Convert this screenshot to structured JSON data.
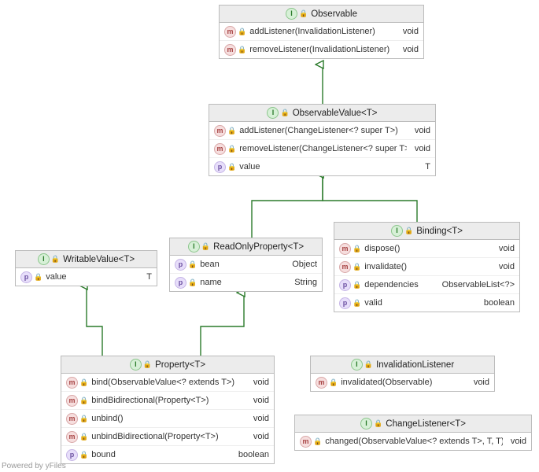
{
  "footer": "Powered by yFiles",
  "nodes": {
    "observable": {
      "title": "Observable",
      "members": [
        {
          "kind": "m",
          "sig": "addListener(InvalidationListener)",
          "ret": "void"
        },
        {
          "kind": "m",
          "sig": "removeListener(InvalidationListener)",
          "ret": "void"
        }
      ]
    },
    "observableValue": {
      "title": "ObservableValue<T>",
      "members": [
        {
          "kind": "m",
          "sig": "addListener(ChangeListener<? super T>)",
          "ret": "void"
        },
        {
          "kind": "m",
          "sig": "removeListener(ChangeListener<? super T>)",
          "ret": "void"
        },
        {
          "kind": "p",
          "sig": "value",
          "ret": "T"
        }
      ]
    },
    "writableValue": {
      "title": "WritableValue<T>",
      "members": [
        {
          "kind": "p",
          "sig": "value",
          "ret": "T"
        }
      ]
    },
    "readOnlyProperty": {
      "title": "ReadOnlyProperty<T>",
      "members": [
        {
          "kind": "p",
          "sig": "bean",
          "ret": "Object"
        },
        {
          "kind": "p",
          "sig": "name",
          "ret": "String"
        }
      ]
    },
    "binding": {
      "title": "Binding<T>",
      "members": [
        {
          "kind": "m",
          "sig": "dispose()",
          "ret": "void"
        },
        {
          "kind": "m",
          "sig": "invalidate()",
          "ret": "void"
        },
        {
          "kind": "p",
          "sig": "dependencies",
          "ret": "ObservableList<?>"
        },
        {
          "kind": "p",
          "sig": "valid",
          "ret": "boolean"
        }
      ]
    },
    "property": {
      "title": "Property<T>",
      "members": [
        {
          "kind": "m",
          "sig": "bind(ObservableValue<? extends T>)",
          "ret": "void"
        },
        {
          "kind": "m",
          "sig": "bindBidirectional(Property<T>)",
          "ret": "void"
        },
        {
          "kind": "m",
          "sig": "unbind()",
          "ret": "void"
        },
        {
          "kind": "m",
          "sig": "unbindBidirectional(Property<T>)",
          "ret": "void"
        },
        {
          "kind": "p",
          "sig": "bound",
          "ret": "boolean"
        }
      ]
    },
    "invalidationListener": {
      "title": "InvalidationListener",
      "members": [
        {
          "kind": "m",
          "sig": "invalidated(Observable)",
          "ret": "void"
        }
      ]
    },
    "changeListener": {
      "title": "ChangeListener<T>",
      "members": [
        {
          "kind": "m",
          "sig": "changed(ObservableValue<? extends T>, T, T)",
          "ret": "void"
        }
      ]
    }
  }
}
